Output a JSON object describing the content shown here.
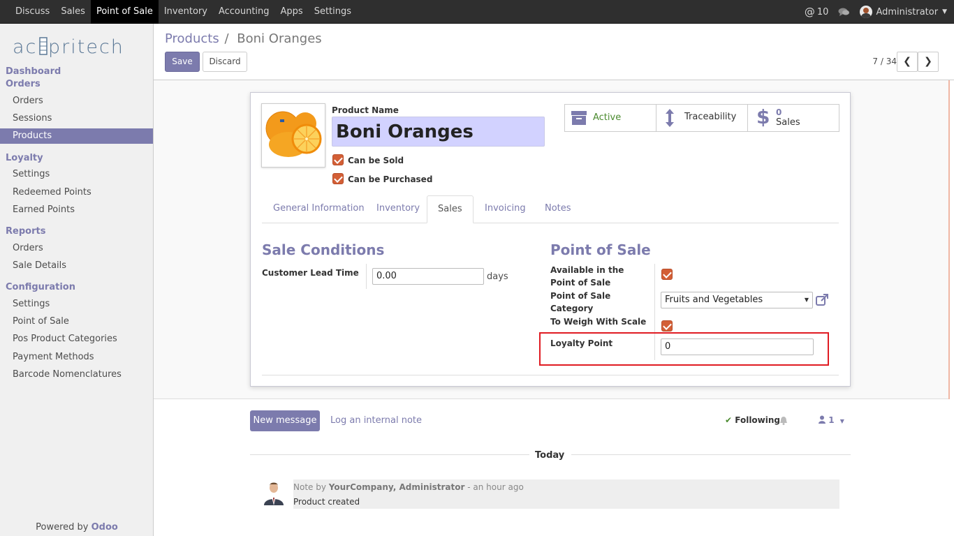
{
  "topbar": {
    "menu": [
      "Discuss",
      "Sales",
      "Point of Sale",
      "Inventory",
      "Accounting",
      "Apps",
      "Settings"
    ],
    "active_menu": "Point of Sale",
    "mentions_count": "10",
    "user": "Administrator"
  },
  "sidebar": {
    "logo": "acspritech",
    "dashboard": "Dashboard",
    "orders_header": "Orders",
    "orders_items": [
      "Orders",
      "Sessions",
      "Products"
    ],
    "loyalty_header": "Loyalty",
    "loyalty_items": [
      "Settings",
      "Redeemed Points",
      "Earned Points"
    ],
    "reports_header": "Reports",
    "reports_items": [
      "Orders",
      "Sale Details"
    ],
    "config_header": "Configuration",
    "config_items": [
      "Settings",
      "Point of Sale",
      "Pos Product Categories",
      "Payment Methods",
      "Barcode Nomenclatures"
    ],
    "powered_by": "Powered by",
    "powered_brand": "Odoo"
  },
  "control": {
    "breadcrumb_parent": "Products",
    "breadcrumb_sep": "/",
    "breadcrumb_current": "Boni Oranges",
    "save": "Save",
    "discard": "Discard",
    "pager": "7 / 34"
  },
  "form": {
    "product_name_label": "Product Name",
    "product_name": "Boni Oranges",
    "can_be_sold": "Can be Sold",
    "can_be_purchased": "Can be Purchased",
    "stat_active": "Active",
    "stat_traceability": "Traceability",
    "stat_sales_count": "0",
    "stat_sales_label": "Sales",
    "tabs": [
      "General Information",
      "Inventory",
      "Sales",
      "Invoicing",
      "Notes"
    ],
    "active_tab": "Sales",
    "sale_conditions_title": "Sale Conditions",
    "customer_lead_time_label": "Customer Lead Time",
    "customer_lead_time": "0.00",
    "days": "days",
    "pos_title": "Point of Sale",
    "available_in_pos_label": "Available in the Point of Sale",
    "pos_category_label": "Point of Sale Category",
    "pos_category": "Fruits and Vegetables",
    "weigh_label": "To Weigh With Scale",
    "loyalty_point_label": "Loyalty Point",
    "loyalty_point": "0"
  },
  "chatter": {
    "new_message": "New message",
    "log_note": "Log an internal note",
    "following": "Following",
    "followers_count": "1",
    "today": "Today",
    "note_prefix": "Note by",
    "author": "YourCompany, Administrator",
    "time": "- an hour ago",
    "body": "Product created"
  },
  "colors": {
    "accent": "#7c7bad",
    "checkbox": "#d35f36",
    "highlight_box": "#e01b22",
    "active_green": "#4a8a2e"
  }
}
